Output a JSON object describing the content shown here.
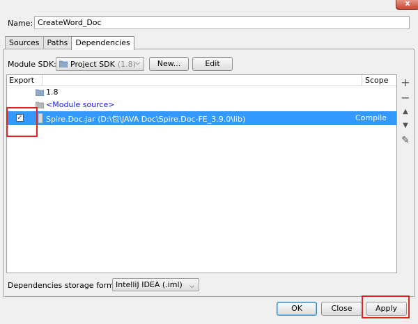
{
  "window": {
    "close_glyph": "x"
  },
  "name_field": {
    "label": "Name:",
    "value": "CreateWord_Doc"
  },
  "tabs": [
    {
      "label": "Sources",
      "active": false
    },
    {
      "label": "Paths",
      "active": false
    },
    {
      "label": "Dependencies",
      "active": true
    }
  ],
  "module_sdk": {
    "label": "Module SDK:",
    "selected": "Project SDK",
    "selected_detail": "(1.8)",
    "new_label": "New...",
    "edit_label": "Edit"
  },
  "dependencies_table": {
    "columns": [
      "Export",
      "Scope"
    ],
    "rows": [
      {
        "name": "1.8",
        "scope": "",
        "checked": null,
        "icon": "folder-icon"
      },
      {
        "name": "<Module source>",
        "scope": "",
        "checked": null,
        "icon": "folder-icon"
      },
      {
        "name": "Spire.Doc.jar (D:\\包\\JAVA Doc\\Spire.Doc-FE_3.9.0\\lib)",
        "scope": "Compile",
        "checked": true,
        "selected": true,
        "icon": "jar-icon"
      }
    ]
  },
  "side_toolbar": {
    "add_icon": "+",
    "remove_icon": "−",
    "up_icon": "▲",
    "down_icon": "▼",
    "edit_icon": "✎"
  },
  "storage_format": {
    "label": "Dependencies storage format:",
    "selected": "IntelliJ IDEA (.iml)"
  },
  "footer": {
    "ok_label": "OK",
    "close_label": "Close",
    "apply_label": "Apply"
  },
  "colors": {
    "selection": "#3399ff",
    "highlight_box": "#e0221f",
    "module_source_text": "#1a1aff"
  }
}
